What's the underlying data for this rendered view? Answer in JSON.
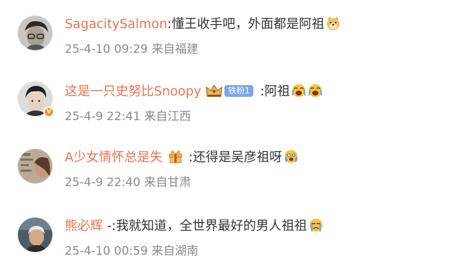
{
  "comments": [
    {
      "username": "SagacitySalmon",
      "separator": ":",
      "text": "懂王收手吧，外面都是阿祖",
      "emojis": [
        "doge-emoji"
      ],
      "time": "25-4-10 09:29",
      "location": "来自福建"
    },
    {
      "username": "这是一只史努比Snoopy",
      "badge_icon": "crown-icon",
      "fan_tag": "铁粉1",
      "separator": " :",
      "text": "阿祖",
      "emojis": [
        "crying-emoji",
        "crying-emoji"
      ],
      "time": "25-4-9 22:41",
      "location": "来自江西"
    },
    {
      "username": "A少女情怀总是失",
      "badge_icon": "gift-box-icon",
      "separator": " :",
      "text": "还得是吴彦祖呀",
      "emojis": [
        "crying-scared-emoji"
      ],
      "time": "25-4-9 22:40",
      "location": "来自甘肃"
    },
    {
      "username": "熊必辉",
      "separator": " -:",
      "text": "我就知道，全世界最好的男人祖祖",
      "emojis": [
        "tearful-emoji"
      ],
      "time": "25-4-10 00:59",
      "location": "来自湖南"
    }
  ],
  "colors": {
    "username": "#eb7350",
    "text": "#333333",
    "meta": "#8a8a8a",
    "fan_tag": "#7aa6e6",
    "verified_badge": "#f7931e"
  }
}
